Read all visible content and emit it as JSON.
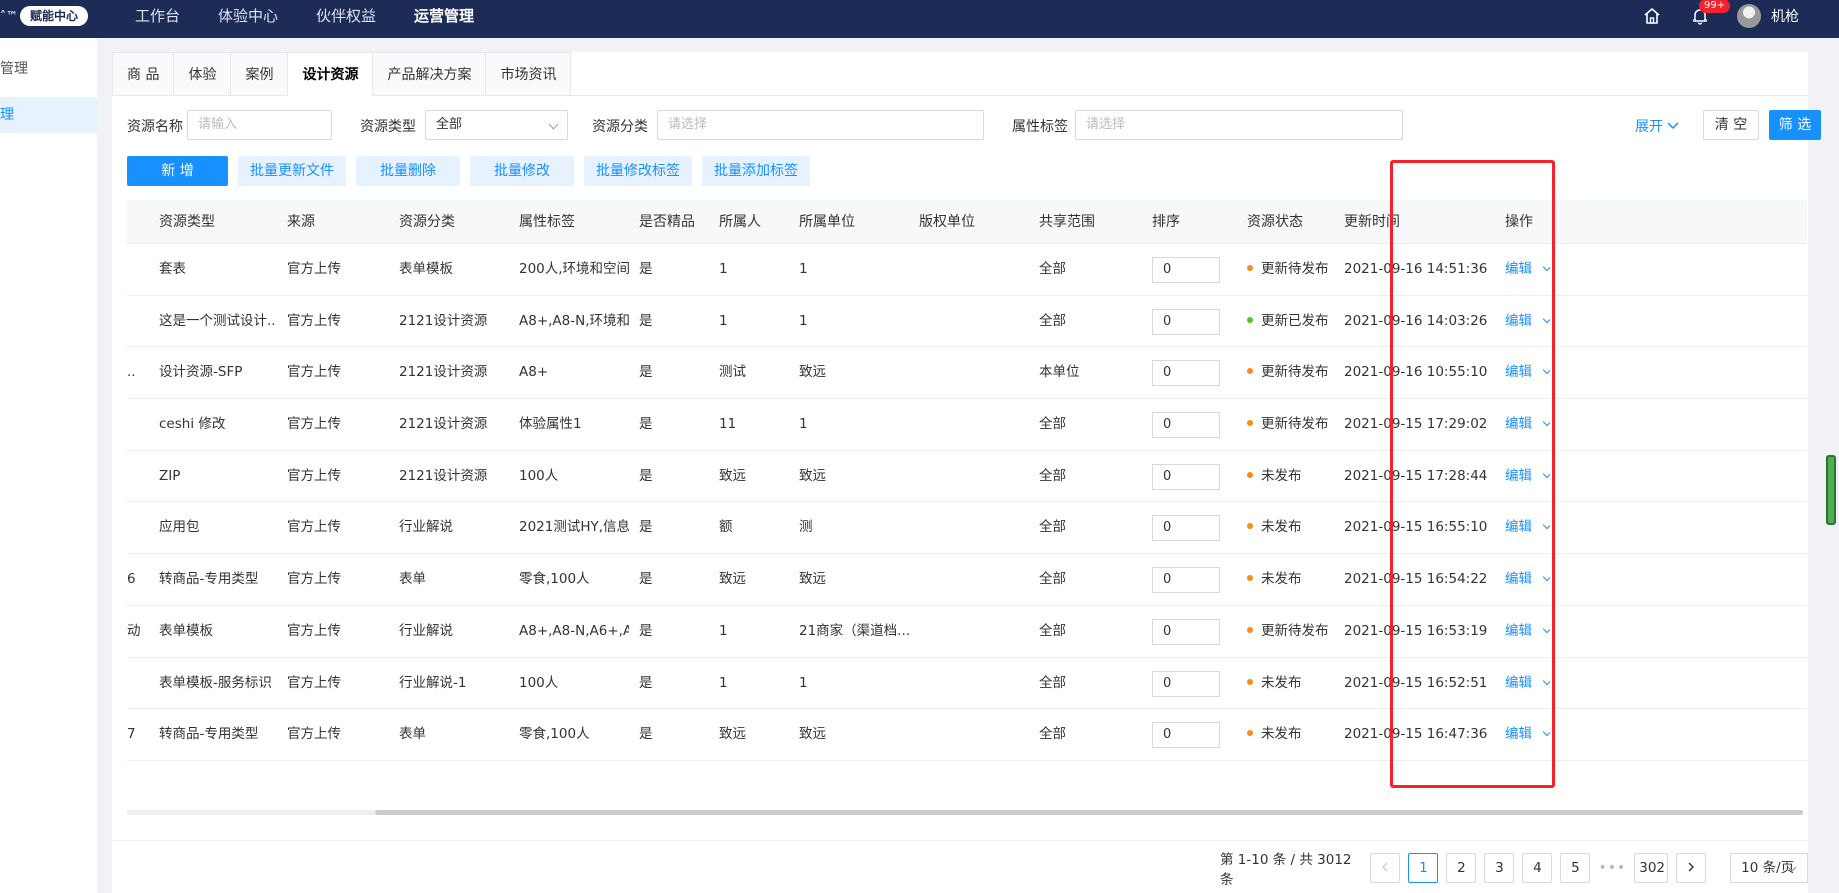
{
  "topbar": {
    "logo_mark": "˄™",
    "logo_badge": "赋能中心",
    "nav": [
      "工作台",
      "体验中心",
      "伙伴权益",
      "运营管理"
    ],
    "nav_active": 3,
    "bell_badge": "99+",
    "user_name": "机枪"
  },
  "sidebar": {
    "items": [
      "管理",
      "理"
    ]
  },
  "tabs": [
    "商 品",
    "体验",
    "案例",
    "设计资源",
    "产品解决方案",
    "市场资讯"
  ],
  "filters": {
    "name_label": "资源名称",
    "name_placeholder": "请输入",
    "type_label": "资源类型",
    "type_value": "全部",
    "category_label": "资源分类",
    "category_placeholder": "请选择",
    "tag_label": "属性标签",
    "tag_placeholder": "请选择",
    "expand": "展开",
    "clear": "清 空",
    "filter": "筛 选"
  },
  "actions": {
    "add": "新 增",
    "batch_update_file": "批量更新文件",
    "batch_delete": "批量删除",
    "batch_modify": "批量修改",
    "batch_modify_tag": "批量修改标签",
    "batch_add_tag": "批量添加标签"
  },
  "table": {
    "headers": [
      "资源类型",
      "来源",
      "资源分类",
      "属性标签",
      "是否精品",
      "所属人",
      "所属单位",
      "版权单位",
      "共享范围",
      "排序",
      "资源状态",
      "更新时间",
      "操作"
    ],
    "status_colors": {
      "更新待发布": "#fa8c16",
      "更新已发布": "#52c41a",
      "未发布": "#fa8c16"
    },
    "rows": [
      {
        "lead": "",
        "type": "套表",
        "source": "官方上传",
        "category": "表单模板",
        "tags": "200人,环境和空间...",
        "premium": "是",
        "owner": "1",
        "unit": "1",
        "copyright": "",
        "scope": "全部",
        "sort": "0",
        "status": "更新待发布",
        "updated": "2021-09-16 14:51:36",
        "op": "编辑"
      },
      {
        "lead": "",
        "type": "这是一个测试设计...",
        "source": "官方上传",
        "category": "2121设计资源",
        "tags": "A8+,A8-N,环境和...",
        "premium": "是",
        "owner": "1",
        "unit": "1",
        "copyright": "",
        "scope": "全部",
        "sort": "0",
        "status": "更新已发布",
        "updated": "2021-09-16 14:03:26",
        "op": "编辑"
      },
      {
        "lead": "..",
        "type": "设计资源-SFP",
        "source": "官方上传",
        "category": "2121设计资源",
        "tags": "A8+",
        "premium": "是",
        "owner": "测试",
        "unit": "致远",
        "copyright": "",
        "scope": "本单位",
        "sort": "0",
        "status": "更新待发布",
        "updated": "2021-09-16 10:55:10",
        "op": "编辑"
      },
      {
        "lead": "",
        "type": "ceshi 修改",
        "source": "官方上传",
        "category": "2121设计资源",
        "tags": "体验属性1",
        "premium": "是",
        "owner": "11",
        "unit": "1",
        "copyright": "",
        "scope": "全部",
        "sort": "0",
        "status": "更新待发布",
        "updated": "2021-09-15 17:29:02",
        "op": "编辑"
      },
      {
        "lead": "",
        "type": "ZIP",
        "source": "官方上传",
        "category": "2121设计资源",
        "tags": "100人",
        "premium": "是",
        "owner": "致远",
        "unit": "致远",
        "copyright": "",
        "scope": "全部",
        "sort": "0",
        "status": "未发布",
        "updated": "2021-09-15 17:28:44",
        "op": "编辑"
      },
      {
        "lead": "",
        "type": "应用包",
        "source": "官方上传",
        "category": "行业解说",
        "tags": "2021测试HY,信息...",
        "premium": "是",
        "owner": "额",
        "unit": "测",
        "copyright": "",
        "scope": "全部",
        "sort": "0",
        "status": "未发布",
        "updated": "2021-09-15 16:55:10",
        "op": "编辑"
      },
      {
        "lead": "6",
        "type": "转商品-专用类型",
        "source": "官方上传",
        "category": "表单",
        "tags": "零食,100人",
        "premium": "是",
        "owner": "致远",
        "unit": "致远",
        "copyright": "",
        "scope": "全部",
        "sort": "0",
        "status": "未发布",
        "updated": "2021-09-15 16:54:22",
        "op": "编辑"
      },
      {
        "lead": "动",
        "type": "表单模板",
        "source": "官方上传",
        "category": "行业解说",
        "tags": "A8+,A8-N,A6+,A6...",
        "premium": "是",
        "owner": "1",
        "unit": "21商家（渠道档...",
        "copyright": "",
        "scope": "全部",
        "sort": "0",
        "status": "更新待发布",
        "updated": "2021-09-15 16:53:19",
        "op": "编辑"
      },
      {
        "lead": "",
        "type": "表单模板-服务标识",
        "source": "官方上传",
        "category": "行业解说-1",
        "tags": "100人",
        "premium": "是",
        "owner": "1",
        "unit": "1",
        "copyright": "",
        "scope": "全部",
        "sort": "0",
        "status": "未发布",
        "updated": "2021-09-15 16:52:51",
        "op": "编辑"
      },
      {
        "lead": "7",
        "type": "转商品-专用类型",
        "source": "官方上传",
        "category": "表单",
        "tags": "零食,100人",
        "premium": "是",
        "owner": "致远",
        "unit": "致远",
        "copyright": "",
        "scope": "全部",
        "sort": "0",
        "status": "未发布",
        "updated": "2021-09-15 16:47:36",
        "op": "编辑"
      }
    ]
  },
  "pagination": {
    "total_text": "第 1-10 条 / 共 3012 条",
    "pages": [
      "1",
      "2",
      "3",
      "4",
      "5"
    ],
    "dots": "•••",
    "last": "302",
    "current": "1",
    "size": "10 条/页"
  }
}
